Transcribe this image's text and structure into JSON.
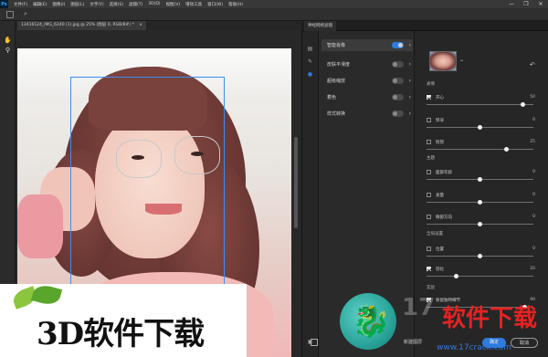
{
  "app": {
    "logo_text": "Ps",
    "menu": [
      "文件(F)",
      "编辑(E)",
      "图像(I)",
      "图层(L)",
      "文字(Y)",
      "选择(S)",
      "滤镜(T)",
      "3D(D)",
      "视图(V)",
      "增效工具",
      "窗口(W)",
      "帮助(H)"
    ],
    "window_controls": [
      "—",
      "❐",
      "✕"
    ]
  },
  "document": {
    "tab_title": "13416124_IMG_6240 (1).jpg @ 25% (图层 0, RGB/8#) *",
    "tab_close": "×"
  },
  "plugin": {
    "title": "神经网络滤镜",
    "filters": [
      {
        "label": "智能肖像",
        "enabled": true,
        "active": true
      },
      {
        "label": "皮肤平滑度",
        "enabled": false,
        "active": false
      },
      {
        "label": "超级缩放",
        "enabled": false,
        "active": false
      },
      {
        "label": "着色",
        "enabled": false,
        "active": false
      },
      {
        "label": "样式转换",
        "enabled": false,
        "active": false
      }
    ],
    "sections": {
      "expression": "表情",
      "theme": "主题",
      "global": "全局设置",
      "experimental": "实验"
    },
    "sliders": [
      {
        "label": "开心",
        "value": "50",
        "checked": true,
        "level": 0.9
      },
      {
        "label": "惊讶",
        "value": "0",
        "checked": false,
        "level": 0.5
      },
      {
        "label": "愤怒",
        "value": "25",
        "checked": false,
        "level": 0.75
      },
      {
        "label": "面部年龄",
        "value": "0",
        "checked": false,
        "level": 0.5
      },
      {
        "label": "发量",
        "value": "0",
        "checked": false,
        "level": 0.5
      },
      {
        "label": "眼部方向",
        "value": "0",
        "checked": false,
        "level": 0.5
      },
      {
        "label": "位置",
        "value": "0",
        "checked": false,
        "level": 0.5
      },
      {
        "label": "羽化",
        "value": "20",
        "checked": true,
        "level": 0.28
      },
      {
        "label": "保留独特细节",
        "value": "90",
        "checked": true,
        "level": 0.92
      }
    ],
    "buttons": {
      "new_layer": "新建图层",
      "ok": "确定",
      "cancel": "取消"
    }
  },
  "watermark": {
    "left_text": "3D软件下载",
    "right_cn_grey": "17",
    "right_cn_red": "软件下载",
    "url": "www.17crack.com"
  },
  "colors": {
    "accent": "#2d7be0",
    "panel_bg": "#262626",
    "menubar": "#383838"
  }
}
